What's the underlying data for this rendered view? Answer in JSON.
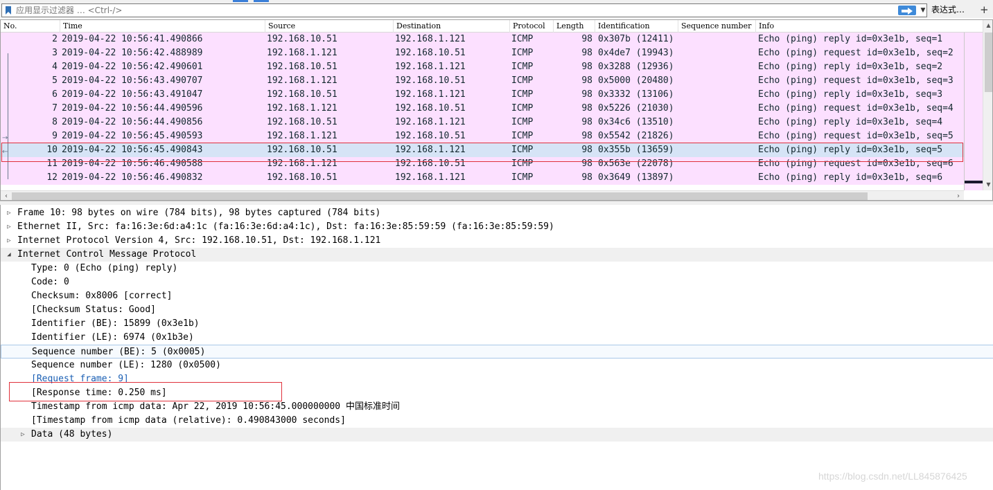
{
  "filter": {
    "placeholder": "应用显示过滤器 … <Ctrl-/>",
    "expression_label": "表达式…",
    "plus_label": "+"
  },
  "columns": [
    "No.",
    "Time",
    "Source",
    "Destination",
    "Protocol",
    "Length",
    "Identification",
    "Sequence number",
    "Info"
  ],
  "packets": [
    {
      "no": "2",
      "time": "2019-04-22 10:56:41.490866",
      "src": "192.168.10.51",
      "dst": "192.168.1.121",
      "proto": "ICMP",
      "len": "98",
      "ident": "0x307b (12411)",
      "seq": "",
      "info": "Echo (ping) reply   id=0x3e1b, seq=1"
    },
    {
      "no": "3",
      "time": "2019-04-22 10:56:42.488989",
      "src": "192.168.1.121",
      "dst": "192.168.10.51",
      "proto": "ICMP",
      "len": "98",
      "ident": "0x4de7 (19943)",
      "seq": "",
      "info": "Echo (ping) request id=0x3e1b, seq=2"
    },
    {
      "no": "4",
      "time": "2019-04-22 10:56:42.490601",
      "src": "192.168.10.51",
      "dst": "192.168.1.121",
      "proto": "ICMP",
      "len": "98",
      "ident": "0x3288 (12936)",
      "seq": "",
      "info": "Echo (ping) reply   id=0x3e1b, seq=2"
    },
    {
      "no": "5",
      "time": "2019-04-22 10:56:43.490707",
      "src": "192.168.1.121",
      "dst": "192.168.10.51",
      "proto": "ICMP",
      "len": "98",
      "ident": "0x5000 (20480)",
      "seq": "",
      "info": "Echo (ping) request id=0x3e1b, seq=3"
    },
    {
      "no": "6",
      "time": "2019-04-22 10:56:43.491047",
      "src": "192.168.10.51",
      "dst": "192.168.1.121",
      "proto": "ICMP",
      "len": "98",
      "ident": "0x3332 (13106)",
      "seq": "",
      "info": "Echo (ping) reply   id=0x3e1b, seq=3"
    },
    {
      "no": "7",
      "time": "2019-04-22 10:56:44.490596",
      "src": "192.168.1.121",
      "dst": "192.168.10.51",
      "proto": "ICMP",
      "len": "98",
      "ident": "0x5226 (21030)",
      "seq": "",
      "info": "Echo (ping) request id=0x3e1b, seq=4"
    },
    {
      "no": "8",
      "time": "2019-04-22 10:56:44.490856",
      "src": "192.168.10.51",
      "dst": "192.168.1.121",
      "proto": "ICMP",
      "len": "98",
      "ident": "0x34c6 (13510)",
      "seq": "",
      "info": "Echo (ping) reply   id=0x3e1b, seq=4"
    },
    {
      "no": "9",
      "time": "2019-04-22 10:56:45.490593",
      "src": "192.168.1.121",
      "dst": "192.168.10.51",
      "proto": "ICMP",
      "len": "98",
      "ident": "0x5542 (21826)",
      "seq": "",
      "info": "Echo (ping) request id=0x3e1b, seq=5"
    },
    {
      "no": "10",
      "time": "2019-04-22 10:56:45.490843",
      "src": "192.168.10.51",
      "dst": "192.168.1.121",
      "proto": "ICMP",
      "len": "98",
      "ident": "0x355b (13659)",
      "seq": "",
      "info": "Echo (ping) reply   id=0x3e1b, seq=5"
    },
    {
      "no": "11",
      "time": "2019-04-22 10:56:46.490588",
      "src": "192.168.1.121",
      "dst": "192.168.10.51",
      "proto": "ICMP",
      "len": "98",
      "ident": "0x563e (22078)",
      "seq": "",
      "info": "Echo (ping) request id=0x3e1b, seq=6"
    },
    {
      "no": "12",
      "time": "2019-04-22 10:56:46.490832",
      "src": "192.168.10.51",
      "dst": "192.168.1.121",
      "proto": "ICMP",
      "len": "98",
      "ident": "0x3649 (13897)",
      "seq": "",
      "info": "Echo (ping) reply   id=0x3e1b, seq=6"
    }
  ],
  "selected_packet_no": "10",
  "details": [
    {
      "text": "Frame 10: 98 bytes on wire (784 bits), 98 bytes captured (784 bits)",
      "level": 0,
      "expander": "collapsed"
    },
    {
      "text": "Ethernet II, Src: fa:16:3e:6d:a4:1c (fa:16:3e:6d:a4:1c), Dst: fa:16:3e:85:59:59 (fa:16:3e:85:59:59)",
      "level": 0,
      "expander": "collapsed"
    },
    {
      "text": "Internet Protocol Version 4, Src: 192.168.10.51, Dst: 192.168.1.121",
      "level": 0,
      "expander": "collapsed"
    },
    {
      "text": "Internet Control Message Protocol",
      "level": 0,
      "expander": "expanded",
      "shaded": true
    },
    {
      "text": "Type: 0 (Echo (ping) reply)",
      "level": 1
    },
    {
      "text": "Code: 0",
      "level": 1
    },
    {
      "text": "Checksum: 0x8006 [correct]",
      "level": 1
    },
    {
      "text": "[Checksum Status: Good]",
      "level": 1
    },
    {
      "text": "Identifier (BE): 15899 (0x3e1b)",
      "level": 1
    },
    {
      "text": "Identifier (LE): 6974 (0x1b3e)",
      "level": 1
    },
    {
      "text": "Sequence number (BE): 5 (0x0005)",
      "level": 1,
      "focused": true
    },
    {
      "text": "Sequence number (LE): 1280 (0x0500)",
      "level": 1
    },
    {
      "text": "[Request frame: 9]",
      "level": 1,
      "link": true
    },
    {
      "text": "[Response time: 0.250 ms]",
      "level": 1
    },
    {
      "text": "Timestamp from icmp data: Apr 22, 2019 10:56:45.000000000 中国标准时间",
      "level": 1
    },
    {
      "text": "[Timestamp from icmp data (relative): 0.490843000 seconds]",
      "level": 1
    },
    {
      "text": "Data (48 bytes)",
      "level": 1,
      "expander": "collapsed",
      "shaded": true
    }
  ],
  "watermark": "https://blog.csdn.net/LL845876425",
  "colors": {
    "icmp_row": "#fce0ff",
    "selected_row": "#d6e4f6",
    "annotation_red": "#e0303a"
  }
}
